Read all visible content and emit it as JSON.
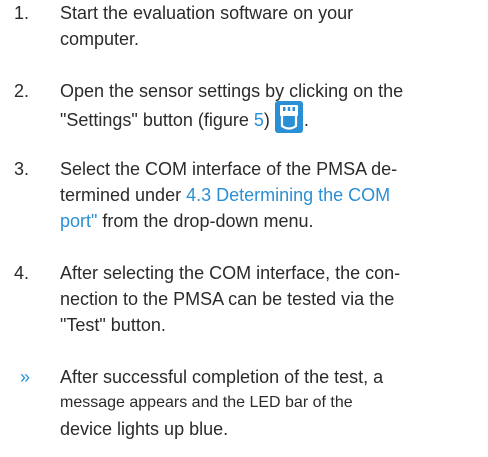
{
  "steps": [
    {
      "number": "1.",
      "lines": [
        "Start the evaluation software on your",
        "computer."
      ]
    },
    {
      "number": "2.",
      "line1": "Open the sensor settings by clicking on the",
      "line2_prefix": "\"Settings\" button (figure ",
      "line2_link": "5",
      "line2_suffix": ")",
      "line2_end": "."
    },
    {
      "number": "3.",
      "line1": "Select the COM interface of the PMSA de-",
      "line2_prefix": "termined under ",
      "line2_link": "4.3 Determining the COM",
      "line3_link": "port\"",
      "line3_suffix": " from the drop-down menu."
    },
    {
      "number": "4.",
      "lines": [
        "After selecting the COM interface, the con-",
        "nection to the PMSA can be tested via the",
        "\"Test\" button."
      ]
    }
  ],
  "result": {
    "marker": "»",
    "lines": [
      "After successful completion of the test, a",
      "message appears and the LED bar of the",
      "device lights up blue."
    ]
  },
  "icons": {
    "settings": "settings-plug-icon",
    "settings_color": "#2a8fd4"
  },
  "colors": {
    "text": "#2b2b2b",
    "link": "#2a8fd4"
  }
}
